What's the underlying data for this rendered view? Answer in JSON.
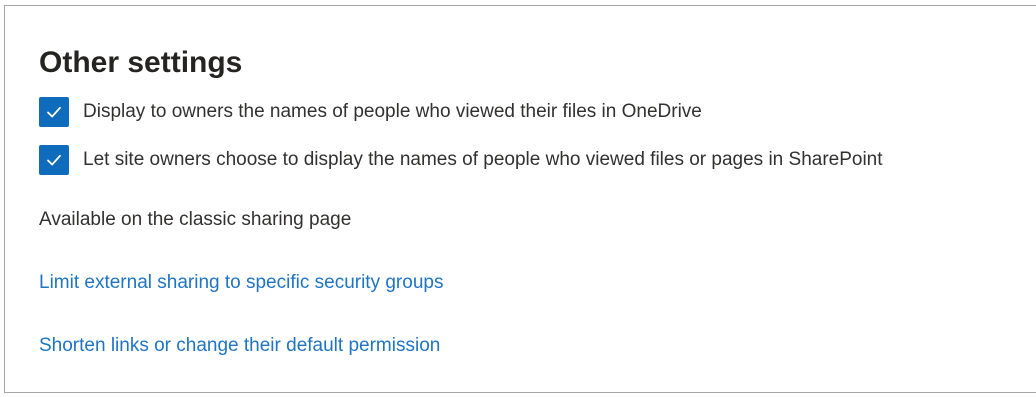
{
  "section": {
    "title": "Other settings",
    "checkboxes": [
      {
        "label": "Display to owners the names of people who viewed their files in OneDrive",
        "checked": true,
        "icon": "checkmark-icon"
      },
      {
        "label": "Let site owners choose to display the names of people who viewed files or pages in SharePoint",
        "checked": true,
        "icon": "checkmark-icon"
      }
    ],
    "classic_note": "Available on the classic sharing page",
    "links": [
      {
        "label": "Limit external sharing to specific security groups"
      },
      {
        "label": "Shorten links or change their default permission"
      }
    ]
  },
  "colors": {
    "accent": "#0f6cbd",
    "link": "#1f74c4",
    "text": "#323130",
    "border": "#a6a6a6"
  }
}
